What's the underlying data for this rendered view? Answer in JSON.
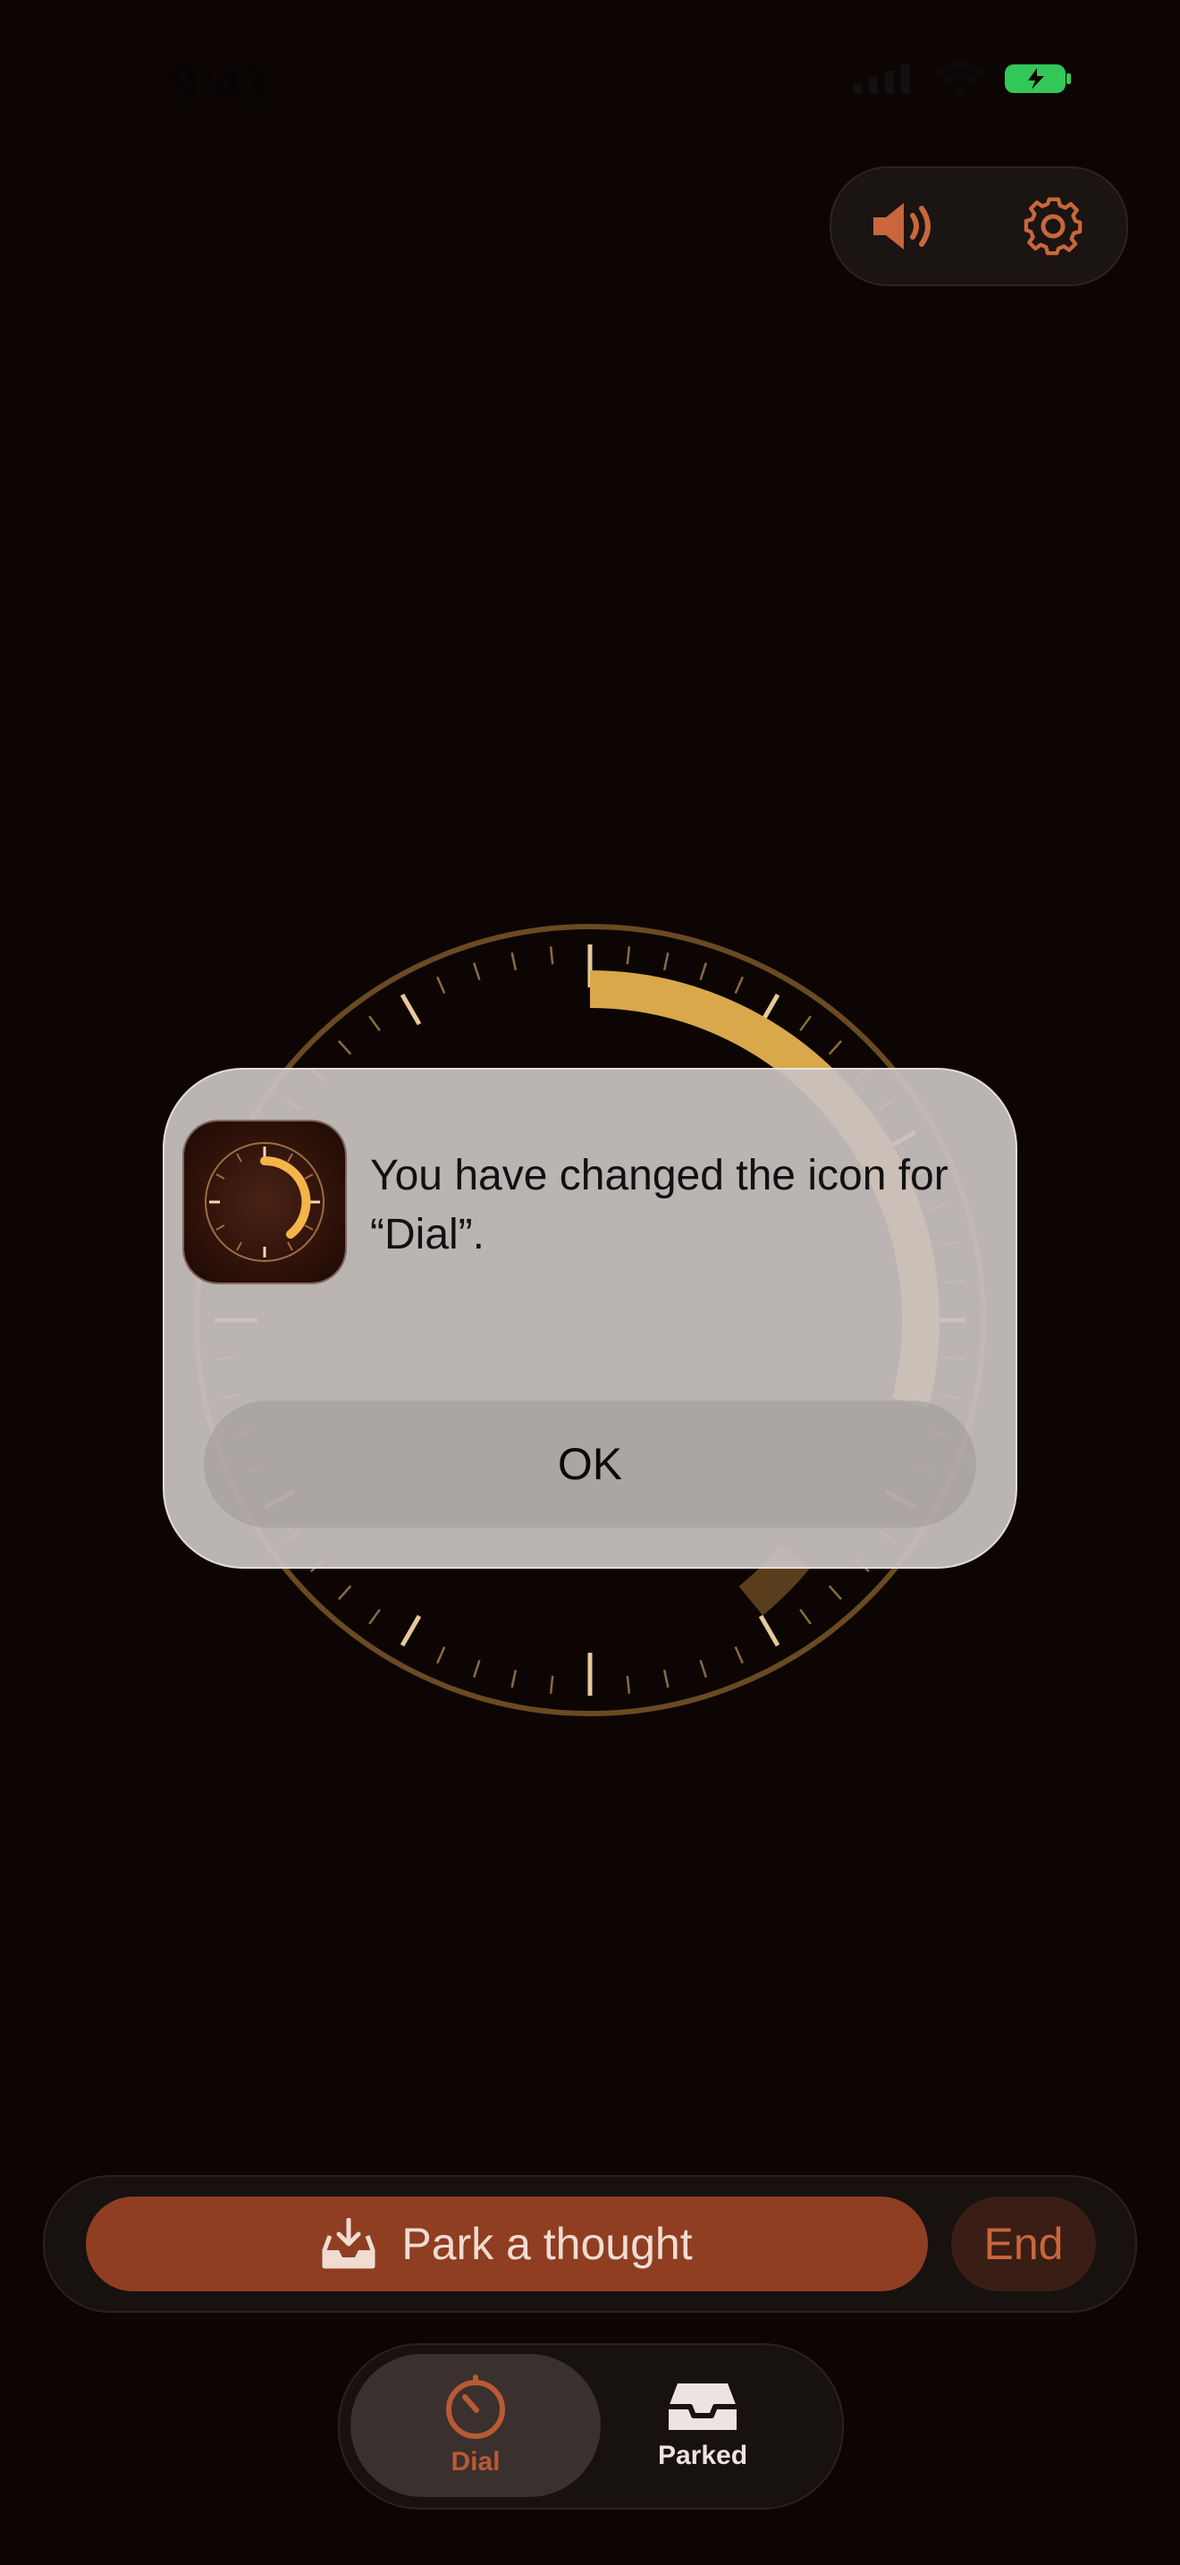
{
  "status_bar": {
    "time": "9:41"
  },
  "top_controls": {
    "sound_icon": "speaker-wave-icon",
    "settings_icon": "gear-icon"
  },
  "dial": {
    "progress": 0.29,
    "accent": "#d9a84a",
    "ring_color": "#6b4a22"
  },
  "alert": {
    "message": "You have changed the icon for “Dial”.",
    "ok_label": "OK",
    "app_icon": "dial-app-icon"
  },
  "action_bar": {
    "park_label": "Park a thought",
    "park_icon": "tray-download-icon",
    "end_label": "End"
  },
  "tab_bar": {
    "tabs": [
      {
        "label": "Dial",
        "icon": "timer-icon",
        "selected": true
      },
      {
        "label": "Parked",
        "icon": "tray-icon",
        "selected": false
      }
    ]
  },
  "colors": {
    "background": "#0c0504",
    "accent": "#8f3e22",
    "accent_text": "#c9663c"
  }
}
